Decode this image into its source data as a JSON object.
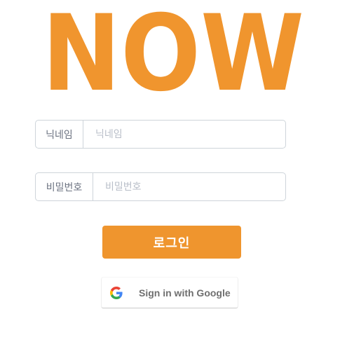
{
  "logo": {
    "text": "NOW",
    "color": "#f0952e"
  },
  "nickname": {
    "label": "닉네임",
    "placeholder": "닉네임",
    "value": ""
  },
  "password": {
    "label": "비밀번호",
    "placeholder": "비밀번호",
    "value": ""
  },
  "login_button": {
    "label": "로그인",
    "color": "#ef952e"
  },
  "google_button": {
    "label": "Sign in with Google",
    "icon": "google-g-icon"
  }
}
